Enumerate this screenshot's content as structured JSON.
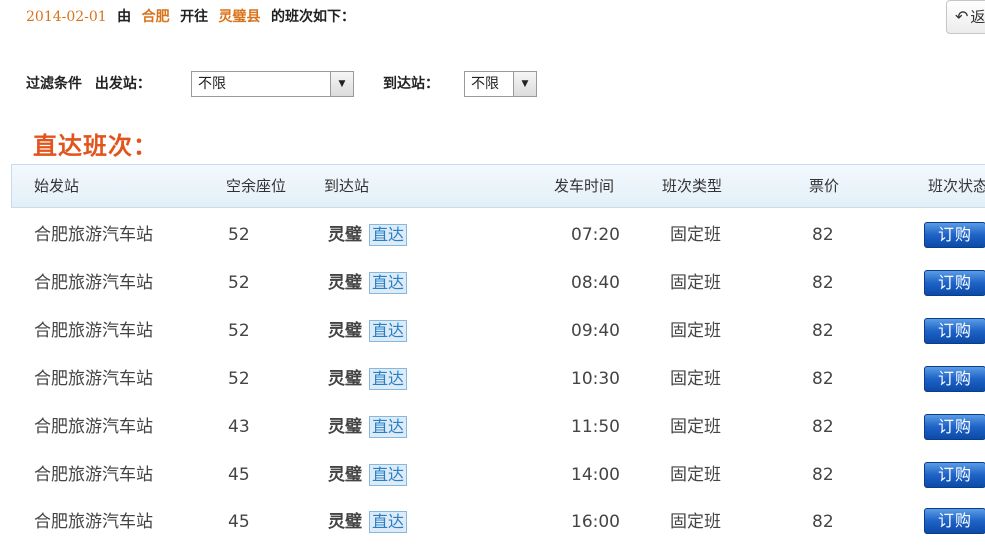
{
  "header": {
    "date": "2014-02-01",
    "from_word": "由",
    "origin": "合肥",
    "to_word": "开往",
    "destination": "灵璧县",
    "suffix": "的班次如下："
  },
  "back_button": {
    "label": "返"
  },
  "filter": {
    "label": "过滤条件",
    "departure_label": "出发站：",
    "departure_value": "不限",
    "arrival_label": "到达站：",
    "arrival_value": "不限"
  },
  "section_title": "直达班次：",
  "columns": [
    "始发站",
    "空余座位",
    "到达站",
    "发车时间",
    "班次类型",
    "票价",
    "班次状态"
  ],
  "direct_tag": "直达",
  "buy_label": "订购",
  "rows": [
    {
      "station": "合肥旅游汽车站",
      "seats": "52",
      "dest": "灵璧",
      "time": "07:20",
      "type": "固定班",
      "price": "82"
    },
    {
      "station": "合肥旅游汽车站",
      "seats": "52",
      "dest": "灵璧",
      "time": "08:40",
      "type": "固定班",
      "price": "82"
    },
    {
      "station": "合肥旅游汽车站",
      "seats": "52",
      "dest": "灵璧",
      "time": "09:40",
      "type": "固定班",
      "price": "82"
    },
    {
      "station": "合肥旅游汽车站",
      "seats": "52",
      "dest": "灵璧",
      "time": "10:30",
      "type": "固定班",
      "price": "82"
    },
    {
      "station": "合肥旅游汽车站",
      "seats": "43",
      "dest": "灵璧",
      "time": "11:50",
      "type": "固定班",
      "price": "82"
    },
    {
      "station": "合肥旅游汽车站",
      "seats": "45",
      "dest": "灵璧",
      "time": "14:00",
      "type": "固定班",
      "price": "82"
    },
    {
      "station": "合肥旅游汽车站",
      "seats": "45",
      "dest": "灵璧",
      "time": "16:00",
      "type": "固定班",
      "price": "82"
    }
  ]
}
